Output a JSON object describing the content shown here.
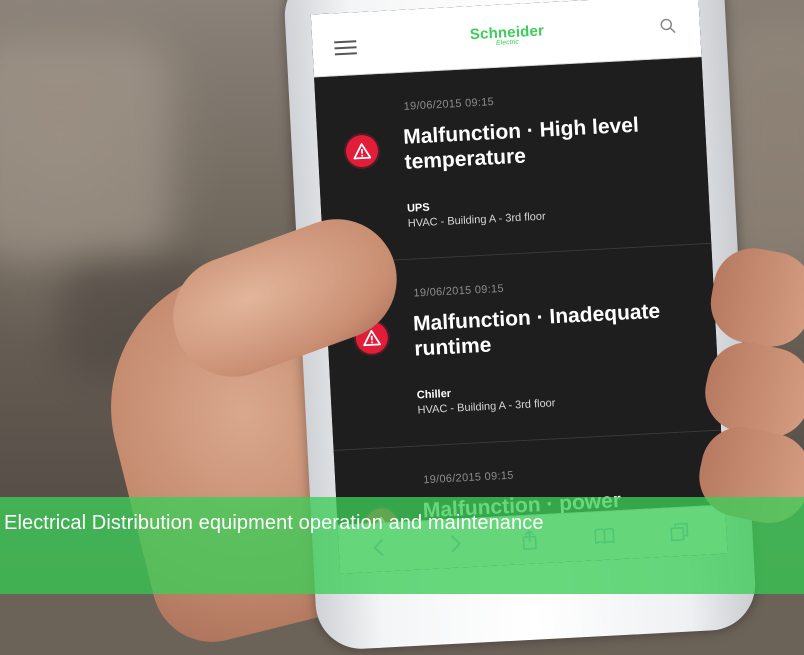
{
  "app": {
    "brand": "Schneider",
    "brand_sub": "Electric"
  },
  "alerts": [
    {
      "timestamp": "19/06/2015 09:15",
      "title": "Malfunction · High level temperature",
      "device": "UPS",
      "location": "HVAC - Building A - 3rd floor"
    },
    {
      "timestamp": "19/06/2015 09:15",
      "title": "Malfunction · Inadequate runtime",
      "device": "Chiller",
      "location": "HVAC - Building A - 3rd floor"
    },
    {
      "timestamp": "19/06/2015 09:15",
      "title": "Malfunction · power",
      "device": "",
      "location": ""
    }
  ],
  "banner": {
    "text": "Electrical Distribution equipment operation and maintenance"
  },
  "colors": {
    "brand_green": "#3dcd58",
    "alert_red": "#e11d3a",
    "list_background": "#1e1e1e"
  },
  "icons": [
    "menu-icon",
    "search-icon",
    "warning-icon",
    "back-icon",
    "forward-icon",
    "share-icon",
    "bookmarks-icon",
    "tabs-icon"
  ]
}
